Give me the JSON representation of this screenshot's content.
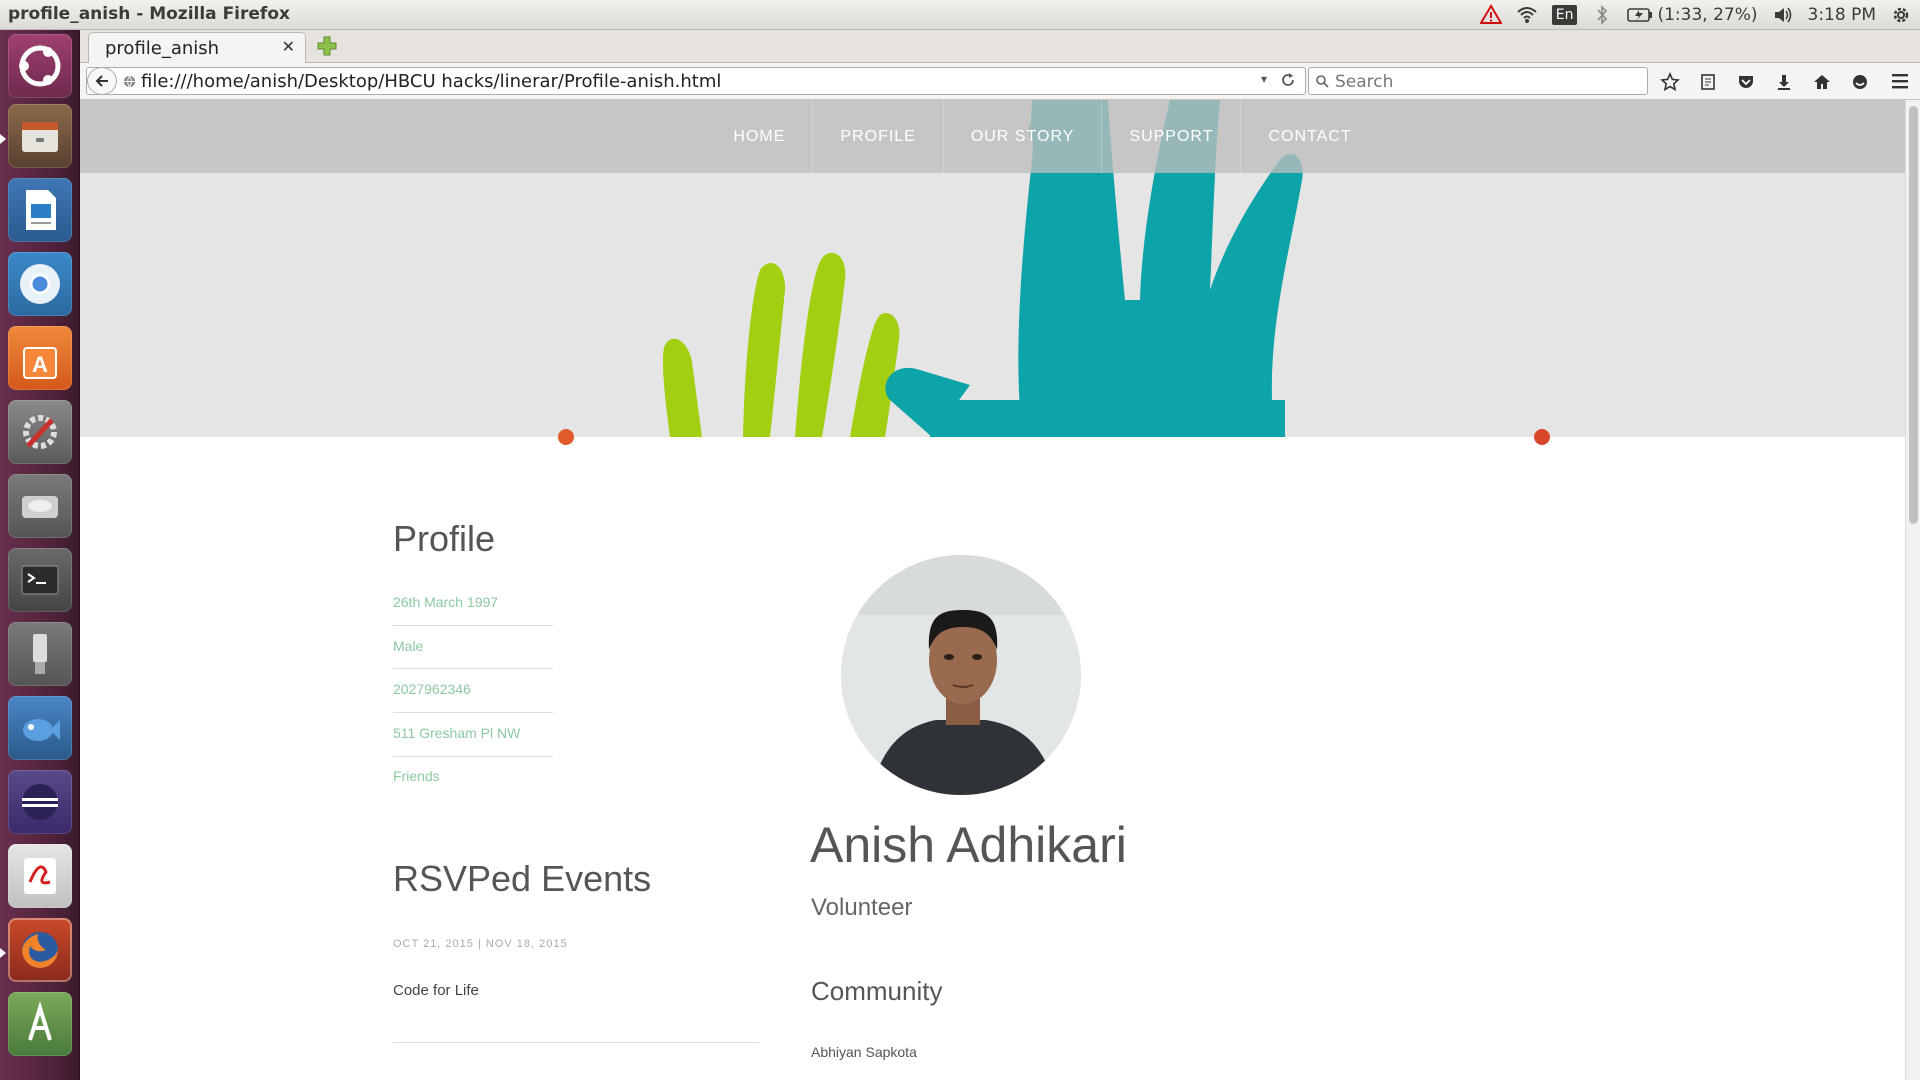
{
  "system": {
    "window_title": "profile_anish - Mozilla Firefox",
    "language": "En",
    "battery": "(1:33, 27%)",
    "clock": "3:18 PM"
  },
  "launcher": {
    "items": [
      "ubuntu-dash",
      "files",
      "libreoffice-impress",
      "chromium",
      "ubuntu-software-center",
      "system-settings",
      "disk-drive",
      "terminal",
      "usb-drive",
      "wireshark",
      "eclipse",
      "evince",
      "firefox",
      "android-studio"
    ]
  },
  "browser": {
    "tab_title": "profile_anish",
    "url": "file:///home/anish/Desktop/HBCU hacks/linerar/Profile-anish.html",
    "search_placeholder": "Search"
  },
  "site": {
    "nav": [
      "HOME",
      "PROFILE",
      "OUR STORY",
      "SUPPORT",
      "CONTACT"
    ],
    "colors": {
      "hand_green": "#a3cf12",
      "hand_teal": "#0ca3a9",
      "accent_link": "#8cc9a0"
    }
  },
  "profile": {
    "heading": "Profile",
    "dob": "26th March 1997",
    "gender": "Male",
    "phone": "2027962346",
    "address": "511 Gresham Pl NW",
    "friends": "Friends",
    "name": "Anish Adhikari",
    "role": "Volunteer"
  },
  "events": {
    "heading": "RSVPed Events",
    "dates": "OCT 21, 2015 | NOV 18, 2015",
    "name": "Code for Life"
  },
  "community": {
    "heading": "Community",
    "member": "Abhiyan Sapkota"
  }
}
